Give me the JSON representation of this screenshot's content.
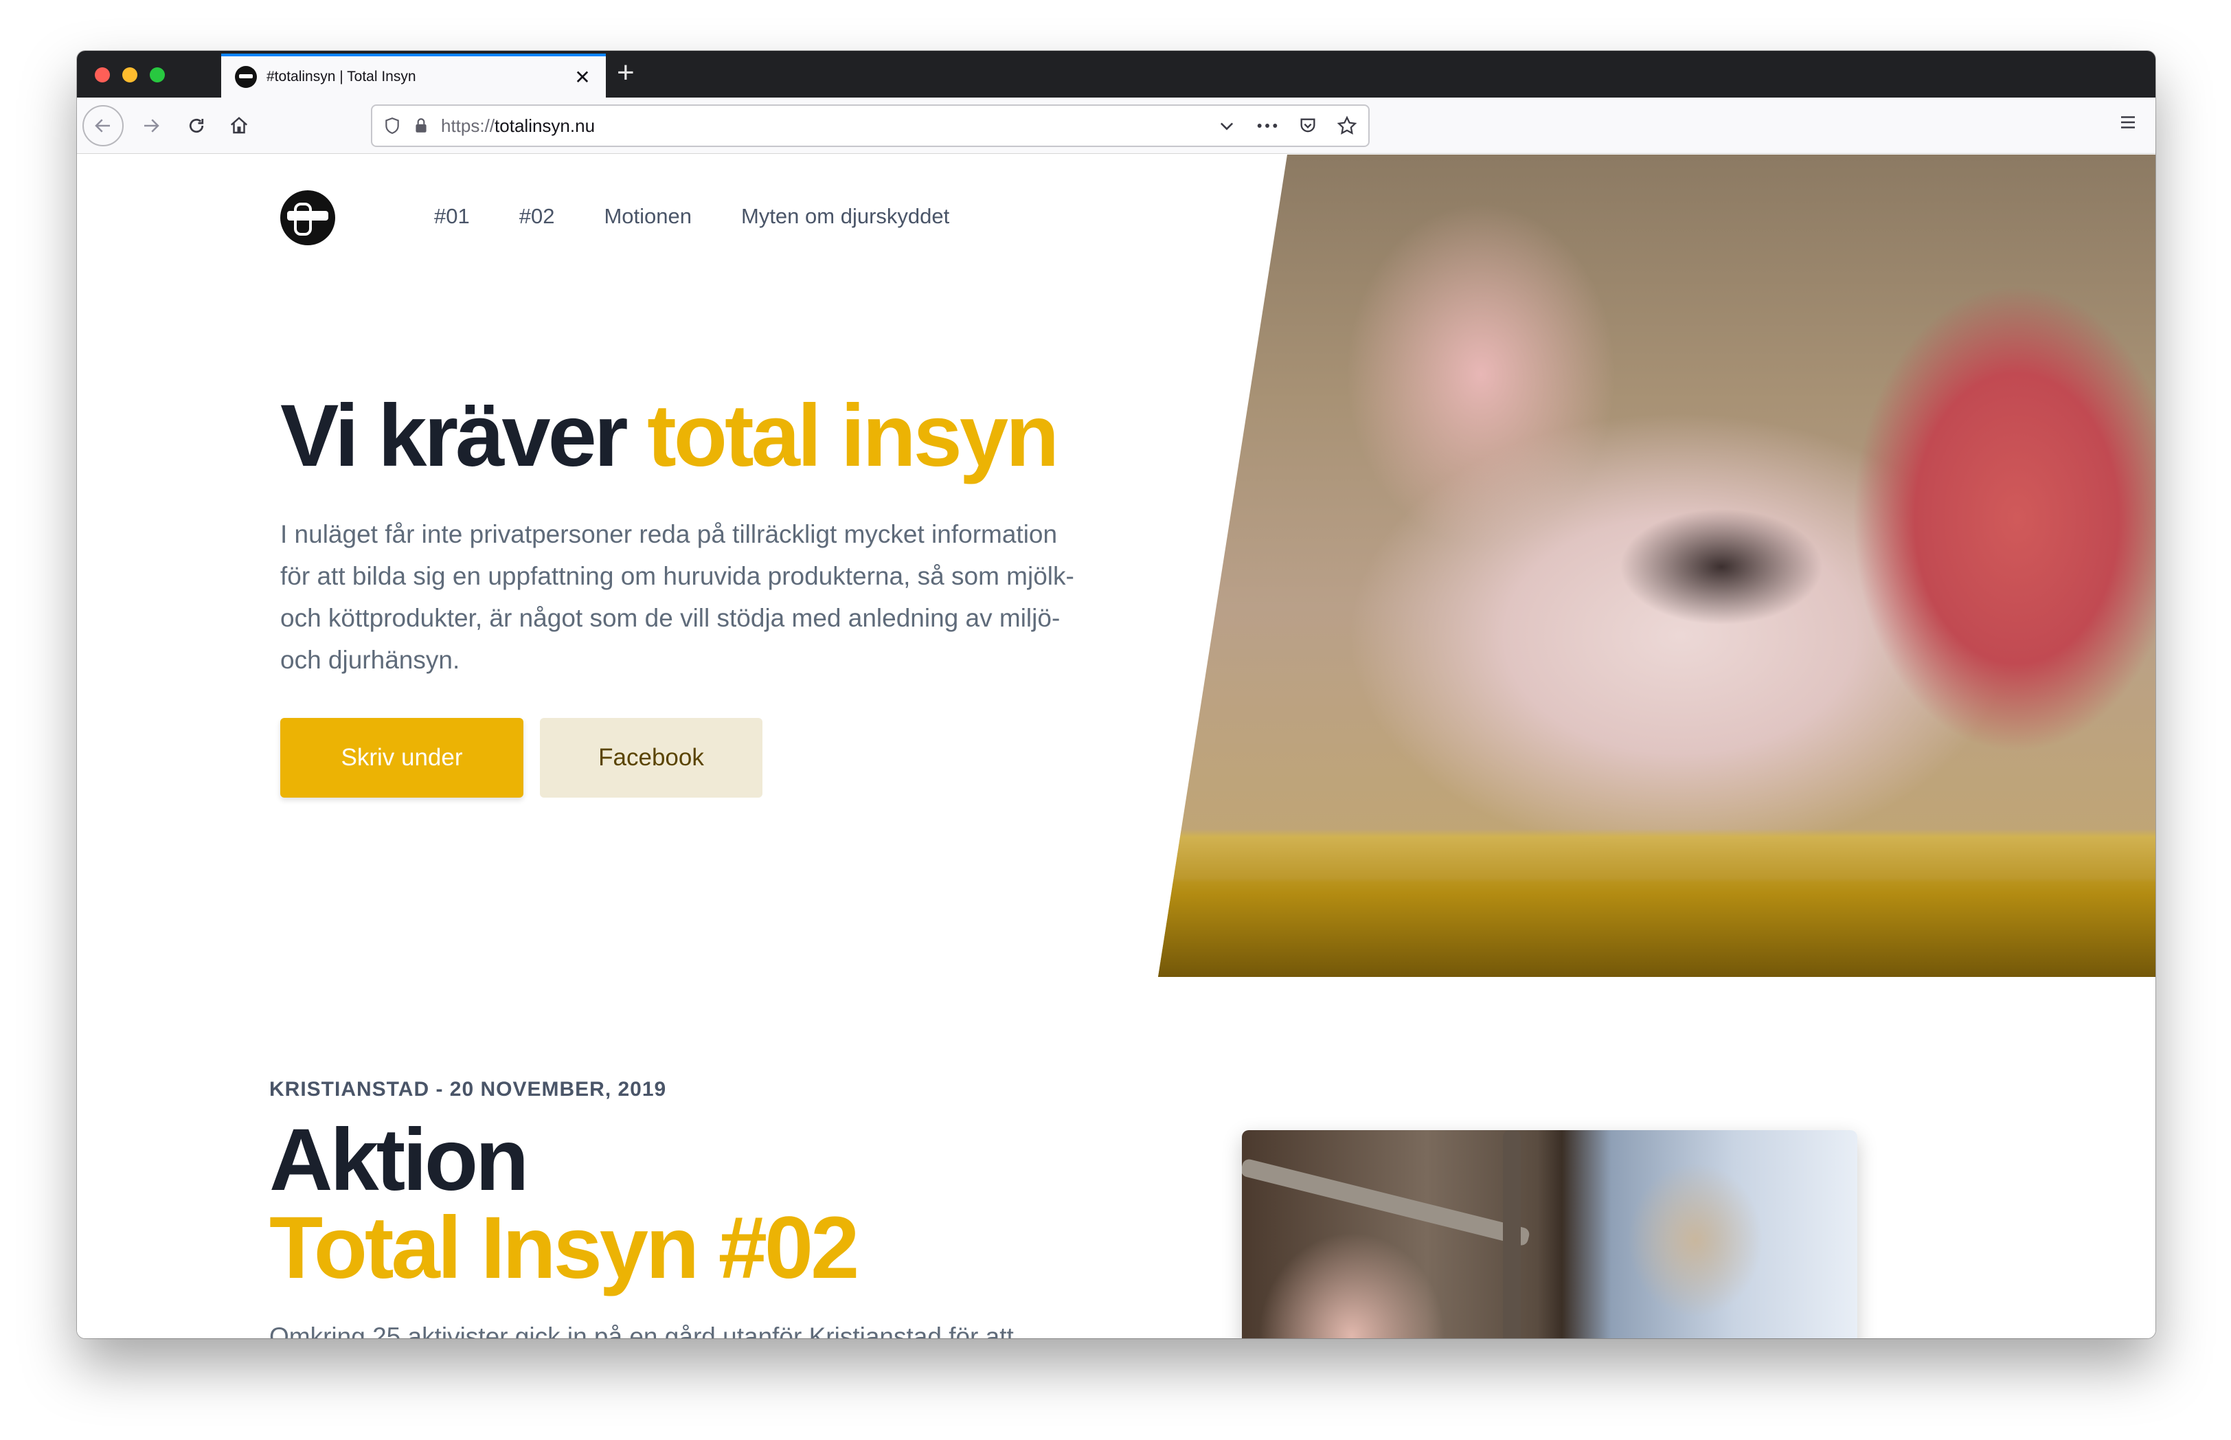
{
  "browser": {
    "tab_title": "#totalinsyn | Total Insyn",
    "tab_close": "✕",
    "new_tab": "+",
    "url_protocol": "https://",
    "url_host": "totalinsyn.nu"
  },
  "nav": {
    "items": [
      "#01",
      "#02",
      "Motionen",
      "Myten om djurskyddet"
    ]
  },
  "hero": {
    "title_plain": "Vi kräver ",
    "title_accent": "total insyn",
    "text": "I nuläget får inte privatpersoner reda på tillräckligt mycket information för att bilda sig en uppfattning om huruvida produkterna, så som mjölk- och köttprodukter, är något som de vill stödja med anledning av miljö- och djurhänsyn.",
    "primary_button": "Skriv under",
    "secondary_button": "Facebook"
  },
  "section": {
    "meta": "KRISTIANSTAD - 20 NOVEMBER, 2019",
    "title_line1": "Aktion",
    "title_line2": "Total Insyn #02",
    "text": "Omkring 25 aktivister gick in på en gård utanför Kristianstad för att"
  },
  "colors": {
    "accent": "#ecb304",
    "heading": "#1a202c",
    "body_text": "#5f6b7a",
    "secondary_button_bg": "#f0ead6",
    "browser_tab_accent": "#0a84ff"
  },
  "icons": {
    "back": "arrow-left-icon",
    "forward": "arrow-right-icon",
    "reload": "reload-icon",
    "home": "home-icon",
    "shield": "shield-icon",
    "lock": "lock-icon",
    "dropdown": "chevron-down-icon",
    "more": "more-icon",
    "pocket": "pocket-icon",
    "bookmark": "star-icon",
    "menu": "hamburger-menu-icon"
  }
}
